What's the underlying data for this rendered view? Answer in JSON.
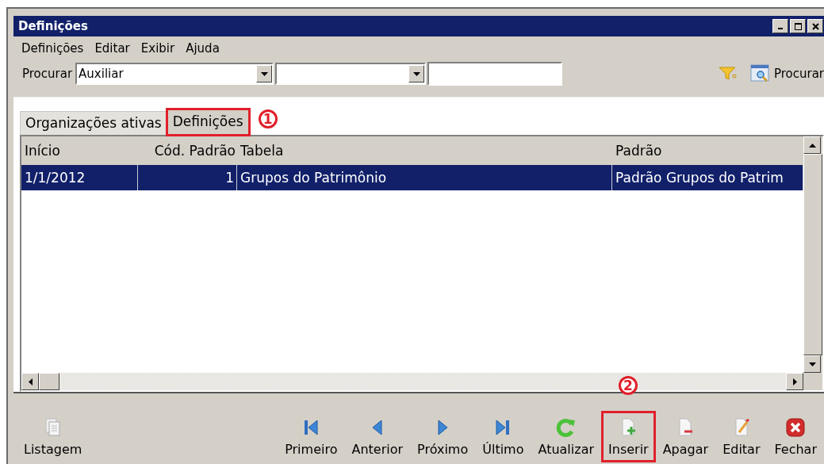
{
  "window": {
    "title": "Definições"
  },
  "menu": [
    "Definições",
    "Editar",
    "Exibir",
    "Ajuda"
  ],
  "search": {
    "label": "Procurar",
    "field_1": "Auxiliar",
    "button": "Procurar"
  },
  "tabs": [
    {
      "label": "Organizações ativas",
      "selected": false,
      "highlighted": false
    },
    {
      "label": "Definições",
      "selected": true,
      "highlighted": true,
      "callout": "1"
    }
  ],
  "table": {
    "columns": [
      "Início",
      "Cód. Padrão",
      "Tabela",
      "Padrão"
    ],
    "rows": [
      {
        "cells": [
          "1/1/2012",
          "1",
          "Grupos do Patrimônio",
          "Padrão Grupos do Patrim"
        ],
        "selected": true
      }
    ]
  },
  "toolbar": [
    {
      "kind": "listing",
      "label": "Listagem",
      "highlighted": false
    },
    {
      "kind": "first",
      "label": "Primeiro",
      "highlighted": false
    },
    {
      "kind": "previous",
      "label": "Anterior",
      "highlighted": false
    },
    {
      "kind": "next",
      "label": "Próximo",
      "highlighted": false
    },
    {
      "kind": "last",
      "label": "Último",
      "highlighted": false
    },
    {
      "kind": "refresh",
      "label": "Atualizar",
      "highlighted": false
    },
    {
      "kind": "insert",
      "label": "Inserir",
      "highlighted": true,
      "callout": "2"
    },
    {
      "kind": "delete",
      "label": "Apagar",
      "highlighted": false
    },
    {
      "kind": "edit",
      "label": "Editar",
      "highlighted": false
    },
    {
      "kind": "close",
      "label": "Fechar",
      "highlighted": false
    }
  ]
}
